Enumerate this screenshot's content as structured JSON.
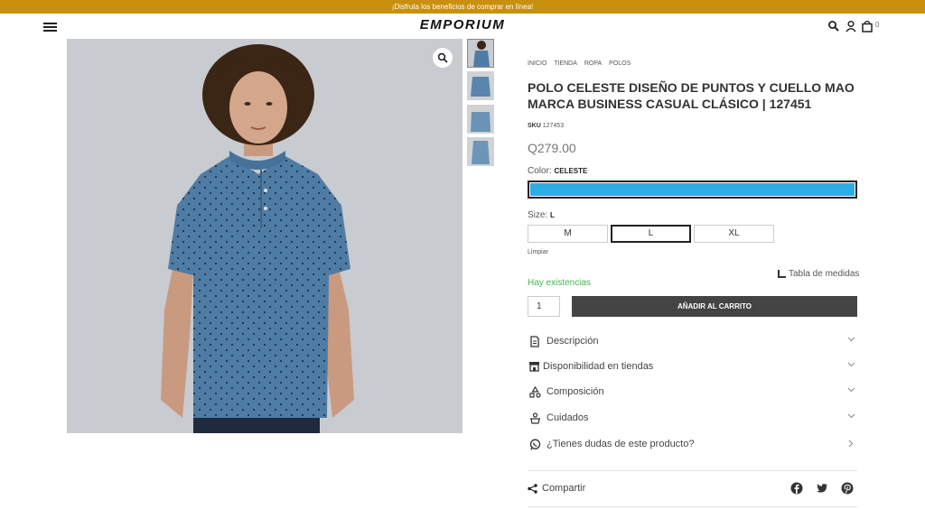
{
  "promo": {
    "text": "¡Disfruta los beneficios de comprar en línea!"
  },
  "header": {
    "logo": "EMPORIUM",
    "cart_count": "0"
  },
  "breadcrumb": [
    "INICIO",
    "TIENDA",
    "ROPA",
    "POLOS"
  ],
  "product": {
    "title": "POLO CELESTE DISEÑO DE PUNTOS Y CUELLO MAO MARCA BUSINESS CASUAL CLÁSICO | 127451",
    "sku_label": "SKU",
    "sku": "127453",
    "price": "Q279.00",
    "color_label": "Color:",
    "color_value": "CELESTE",
    "swatch_color": "#2aaee4",
    "size_label": "Size:",
    "size_value": "L",
    "sizes": [
      "M",
      "L",
      "XL"
    ],
    "clear_label": "Limpiar",
    "size_chart": "Tabla de medidas",
    "stock": "Hay existencias",
    "qty": "1",
    "add_to_cart": "AÑADIR AL CARRITO"
  },
  "accordion": [
    {
      "label": "Descripción",
      "icon": "document-icon"
    },
    {
      "label": "Disponibilidad en tiendas",
      "icon": "store-icon"
    },
    {
      "label": "Composición",
      "icon": "shapes-icon"
    },
    {
      "label": "Cuidados",
      "icon": "care-icon"
    },
    {
      "label": "¿Tienes dudas de este producto?",
      "icon": "whatsapp-icon"
    }
  ],
  "share": {
    "label": "Compartir"
  },
  "colors": {
    "accent": "#c8900e",
    "button": "#444444",
    "stock": "#4caf50"
  }
}
